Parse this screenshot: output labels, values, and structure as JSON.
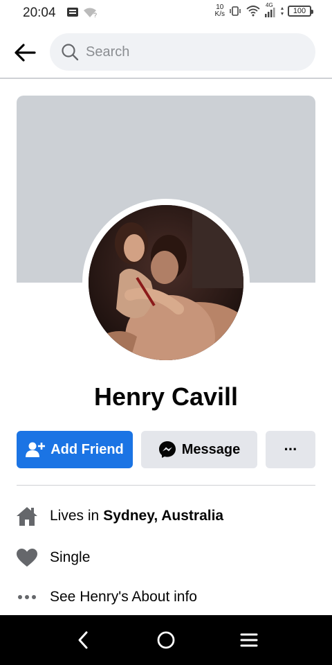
{
  "status_bar": {
    "time": "20:04",
    "net_speed_value": "10",
    "net_speed_unit": "K/s",
    "network_type": "4G",
    "battery": "100"
  },
  "header": {
    "search_placeholder": "Search"
  },
  "profile": {
    "name": "Henry Cavill"
  },
  "actions": {
    "add_friend": "Add Friend",
    "message": "Message",
    "more": "···"
  },
  "info": {
    "lives_prefix": "Lives in",
    "lives_place": "Sydney, Australia",
    "relationship": "Single",
    "about_link": "See Henry's About info"
  },
  "colors": {
    "accent": "#1b74e4",
    "secondary_button": "#e4e6eb",
    "cover": "#ccd0d5",
    "search_bg": "#f0f2f5"
  },
  "icons": [
    "back-arrow-icon",
    "search-icon",
    "add-friend-icon",
    "messenger-icon",
    "more-icon",
    "home-icon",
    "heart-icon",
    "dots-icon",
    "nav-back-icon",
    "nav-home-icon",
    "nav-menu-icon"
  ]
}
